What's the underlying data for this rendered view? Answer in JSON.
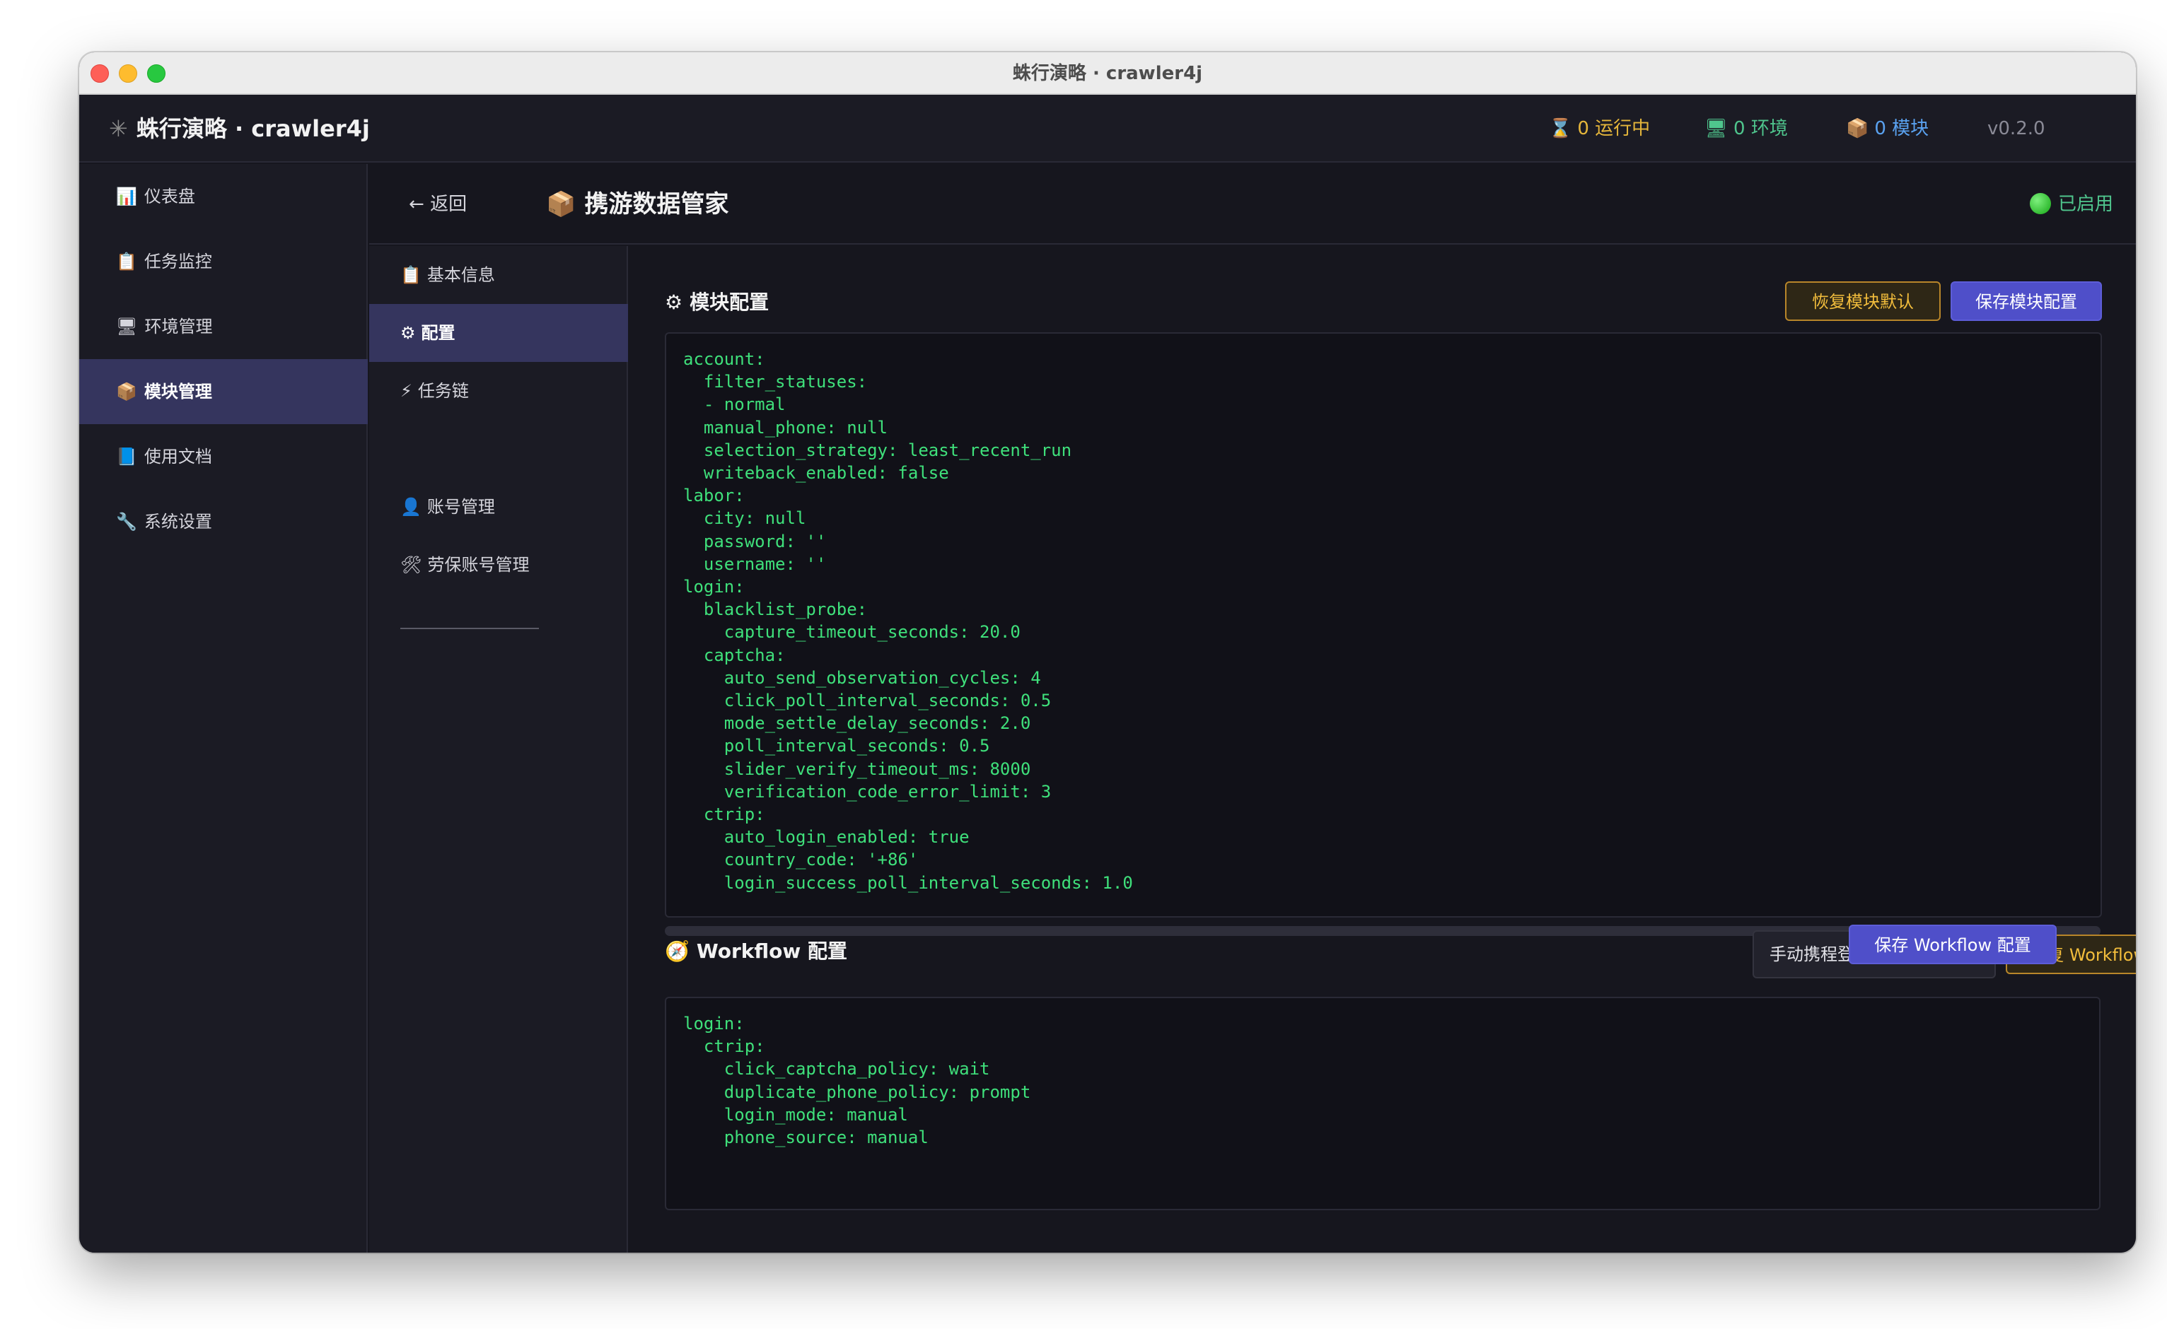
{
  "window": {
    "title": "蛛行演略 · crawler4j"
  },
  "header": {
    "brand_icon": "spider-icon",
    "brand": "蛛行演略 · crawler4j",
    "stats": {
      "running": "0 运行中",
      "env": "0 环境",
      "modules": "0 模块"
    },
    "version": "v0.2.0"
  },
  "sidebar": {
    "items": [
      {
        "icon": "📊",
        "label": "仪表盘"
      },
      {
        "icon": "📋",
        "label": "任务监控"
      },
      {
        "icon": "🖥",
        "label": "环境管理"
      },
      {
        "icon": "📦",
        "label": "模块管理"
      },
      {
        "icon": "📘",
        "label": "使用文档"
      },
      {
        "icon": "🔧",
        "label": "系统设置"
      }
    ],
    "active_index": 3
  },
  "main": {
    "back_label": "返回",
    "title": "携游数据管家",
    "status": "已启用"
  },
  "subnav": {
    "items": [
      {
        "icon": "📋",
        "label": "基本信息"
      },
      {
        "icon": "⚙",
        "label": "配置"
      },
      {
        "icon": "⚡",
        "label": "任务链"
      },
      {
        "icon": "👤",
        "label": "账号管理"
      },
      {
        "icon": "🛠",
        "label": "劳保账号管理"
      }
    ],
    "active_index": 1
  },
  "module_config": {
    "title": "模块配置",
    "reset_label": "恢复模块默认",
    "save_label": "保存模块配置",
    "code": "account:\n  filter_statuses:\n  - normal\n  manual_phone: null\n  selection_strategy: least_recent_run\n  writeback_enabled: false\nlabor:\n  city: null\n  password: ''\n  username: ''\nlogin:\n  blacklist_probe:\n    capture_timeout_seconds: 20.0\n  captcha:\n    auto_send_observation_cycles: 4\n    click_poll_interval_seconds: 0.5\n    mode_settle_delay_seconds: 2.0\n    poll_interval_seconds: 0.5\n    slider_verify_timeout_ms: 8000\n    verification_code_error_limit: 3\n  ctrip:\n    auto_login_enabled: true\n    country_code: '+86'\n    login_success_poll_interval_seconds: 1.0"
  },
  "workflow_config": {
    "title": "Workflow 配置",
    "select_value": "手动携程登录",
    "reset_label": "恢复 Workflow 默认",
    "save_label": "保存 Workflow 配置",
    "code": "login:\n  ctrip:\n    click_captcha_policy: wait\n    duplicate_phone_policy: prompt\n    login_mode: manual\n    phone_source: manual"
  },
  "colors": {
    "accent": "#4f4fc9",
    "warn": "#f2bd3c",
    "code": "#3fe07b",
    "success": "#4fc58d"
  }
}
